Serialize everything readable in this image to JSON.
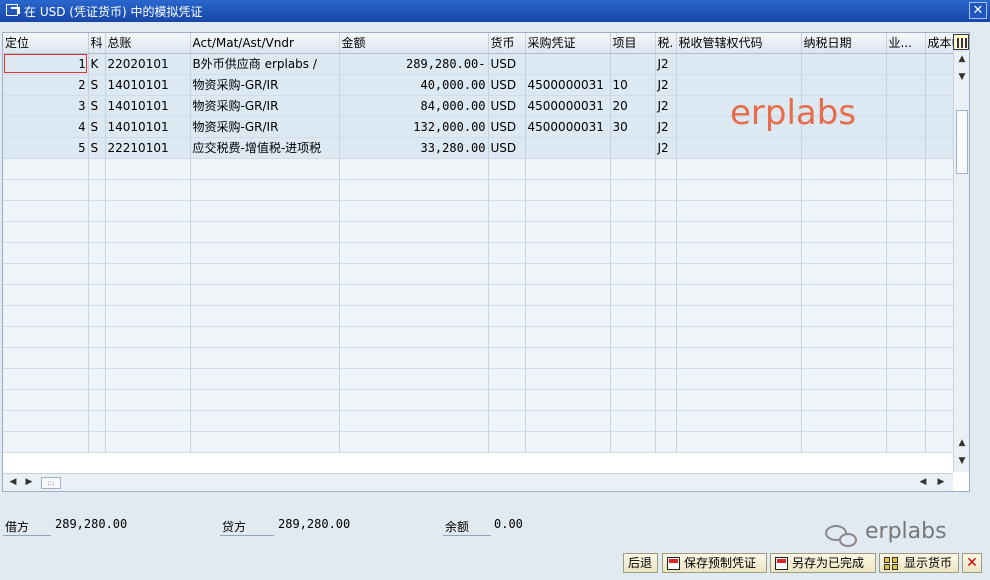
{
  "window": {
    "title": "在 USD (凭证货币) 中的模拟凭证",
    "close_label": "✕"
  },
  "grid": {
    "columns": [
      "定位",
      "科",
      "总账",
      "Act/Mat/Ast/Vndr",
      "金额",
      "货币",
      "采购凭证",
      "项目",
      "税.",
      "税收管辖权代码",
      "纳税日期",
      "业...",
      "成本中"
    ],
    "rows": [
      [
        "1",
        "K",
        "22020101",
        "B外币供应商 erplabs /",
        "289,280.00-",
        "USD",
        "",
        "",
        "J2",
        "",
        "",
        "",
        ""
      ],
      [
        "2",
        "S",
        "14010101",
        "物资采购-GR/IR",
        "40,000.00",
        "USD",
        "4500000031",
        "10",
        "J2",
        "",
        "",
        "",
        ""
      ],
      [
        "3",
        "S",
        "14010101",
        "物资采购-GR/IR",
        "84,000.00",
        "USD",
        "4500000031",
        "20",
        "J2",
        "",
        "",
        "",
        ""
      ],
      [
        "4",
        "S",
        "14010101",
        "物资采购-GR/IR",
        "132,000.00",
        "USD",
        "4500000031",
        "30",
        "J2",
        "",
        "",
        "",
        ""
      ],
      [
        "5",
        "S",
        "22210101",
        "应交税费-增值税-进项税",
        "33,280.00",
        "USD",
        "",
        "",
        "J2",
        "",
        "",
        "",
        ""
      ]
    ],
    "empty_rows": 14
  },
  "watermark": "erplabs",
  "totals": {
    "debit_label": "借方",
    "debit_value": "289,280.00",
    "credit_label": "贷方",
    "credit_value": "289,280.00",
    "balance_label": "余额",
    "balance_value": "0.00"
  },
  "brand": "erplabs",
  "toolbar": {
    "back": "后退",
    "save_parked": "保存预制凭证",
    "save_completed": "另存为已完成",
    "show_currency": "显示货币",
    "cancel": "✕"
  },
  "colors": {
    "title_bar": "#1f57be",
    "watermark": "#e86b4a",
    "row_selected": "#dce8f2"
  }
}
